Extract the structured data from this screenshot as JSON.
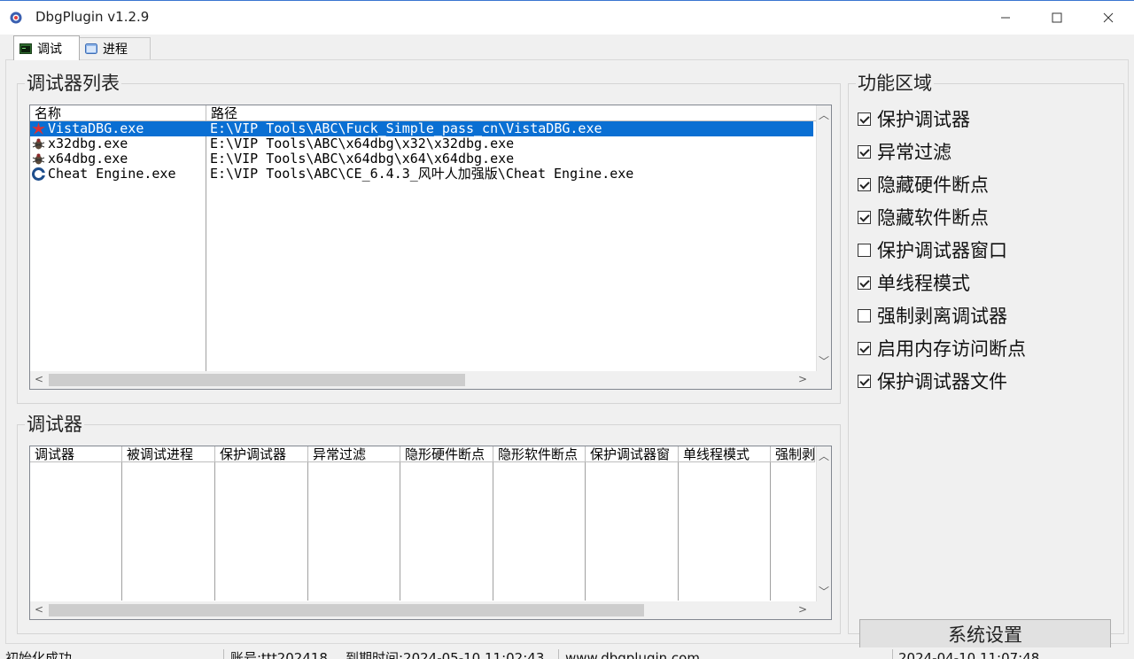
{
  "window": {
    "title": "DbgPlugin v1.2.9"
  },
  "tabs": [
    {
      "label": "调试",
      "icon": "terminal-icon"
    },
    {
      "label": "进程",
      "icon": "window-icon"
    }
  ],
  "debugger_list": {
    "legend": "调试器列表",
    "columns": [
      "名称",
      "路径"
    ],
    "rows": [
      {
        "name": "VistaDBG.exe",
        "path": "E:\\VIP Tools\\ABC\\Fuck_Simple_pass_cn\\VistaDBG.exe",
        "icon": "vistadbg-icon",
        "selected": true
      },
      {
        "name": "x32dbg.exe",
        "path": "E:\\VIP Tools\\ABC\\x64dbg\\x32\\x32dbg.exe",
        "icon": "bug-icon",
        "selected": false
      },
      {
        "name": "x64dbg.exe",
        "path": "E:\\VIP Tools\\ABC\\x64dbg\\x64\\x64dbg.exe",
        "icon": "bug-icon",
        "selected": false
      },
      {
        "name": "Cheat Engine.exe",
        "path": "E:\\VIP Tools\\ABC\\CE_6.4.3_风叶人加强版\\Cheat Engine.exe",
        "icon": "cheat-engine-icon",
        "selected": false
      }
    ]
  },
  "debugger_table": {
    "legend": "调试器",
    "columns": [
      "调试器",
      "被调试进程",
      "保护调试器",
      "异常过滤",
      "隐形硬件断点",
      "隐形软件断点",
      "保护调试器窗",
      "单线程模式",
      "强制剥"
    ]
  },
  "functions": {
    "legend": "功能区域",
    "options": [
      {
        "label": "保护调试器",
        "checked": true
      },
      {
        "label": "异常过滤",
        "checked": true
      },
      {
        "label": "隐藏硬件断点",
        "checked": true
      },
      {
        "label": "隐藏软件断点",
        "checked": true
      },
      {
        "label": "保护调试器窗口",
        "checked": false
      },
      {
        "label": "单线程模式",
        "checked": true
      },
      {
        "label": "强制剥离调试器",
        "checked": false
      },
      {
        "label": "启用内存访问断点",
        "checked": true
      },
      {
        "label": "保护调试器文件",
        "checked": true
      }
    ],
    "settings_button": "系统设置"
  },
  "status": {
    "message": "初始化成功",
    "account": "账号:ttt202418",
    "expiry": "到期时间:2024-05-10 11:02:43",
    "website": "www.dbgplugin.com",
    "datetime": "2024-04-10 11:07:48"
  },
  "colors": {
    "selection": "#0a6fd3",
    "title_accent": "#3a76d0"
  }
}
